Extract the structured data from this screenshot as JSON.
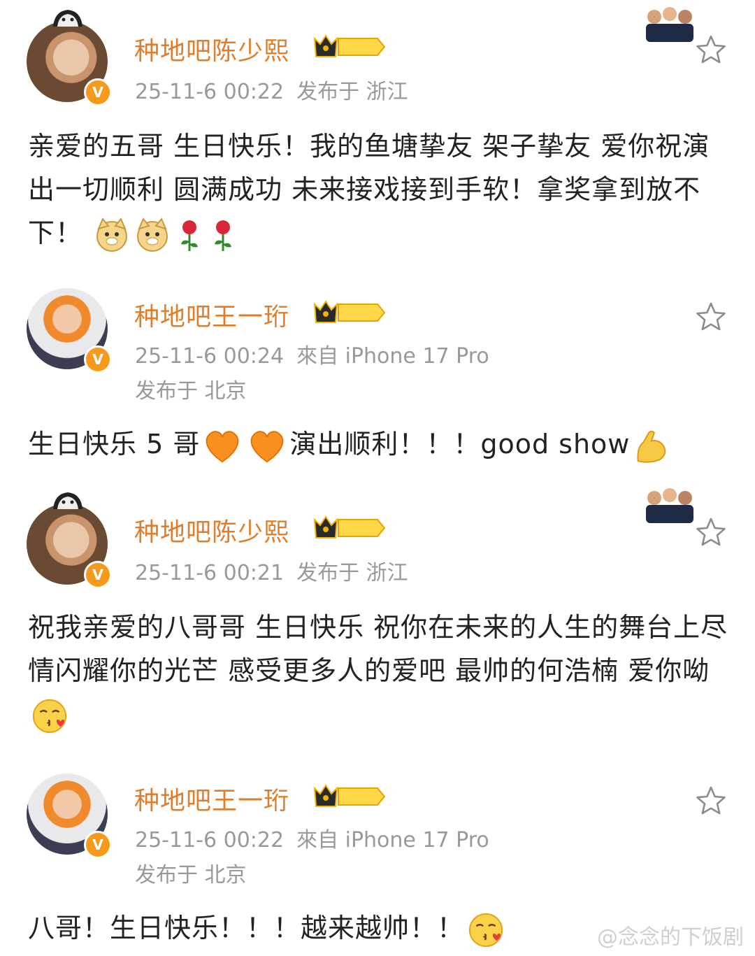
{
  "colors": {
    "username": "#e07d2a",
    "meta": "#999999",
    "body_text": "#222222",
    "vip_badge": "#f59a1a"
  },
  "posts": [
    {
      "username": "种地吧陈少熙",
      "level_badge": "I",
      "time": "25-11-6 00:22",
      "source": "",
      "location": "发布于 浙江",
      "text": "亲爱的五哥 生日快乐！我的鱼塘挚友 架子挚友 爱你祝演出一切顺利 圆满成功 未来接戏接到手软！拿奖拿到放不下！",
      "emojis": [
        "doge-emoji",
        "doge-emoji",
        "rose-emoji",
        "rose-emoji"
      ]
    },
    {
      "username": "种地吧王一珩",
      "level_badge": "III",
      "time": "25-11-6 00:24",
      "source": "來自 iPhone 17 Pro",
      "location": "发布于 北京",
      "text_parts": [
        "生日快乐 5 哥",
        "演出顺利！！！good show"
      ],
      "emojis": [
        "orange-heart-emoji",
        "orange-heart-emoji",
        "flexed-biceps-emoji"
      ]
    },
    {
      "username": "种地吧陈少熙",
      "level_badge": "I",
      "time": "25-11-6 00:21",
      "source": "",
      "location": "发布于 浙江",
      "text": "祝我亲爱的八哥哥 生日快乐 祝你在未来的人生的舞台上尽情闪耀你的光芒 感受更多人的爱吧 最帅的何浩楠 爱你呦",
      "emojis": [
        "kissing-face-emoji"
      ]
    },
    {
      "username": "种地吧王一珩",
      "level_badge": "III",
      "time": "25-11-6 00:22",
      "source": "來自 iPhone 17 Pro",
      "location": "发布于 北京",
      "text": "八哥！生日快乐！！！越来越帅！！",
      "emojis": [
        "kissing-face-emoji"
      ]
    }
  ],
  "watermark": "@念念的下饭剧"
}
